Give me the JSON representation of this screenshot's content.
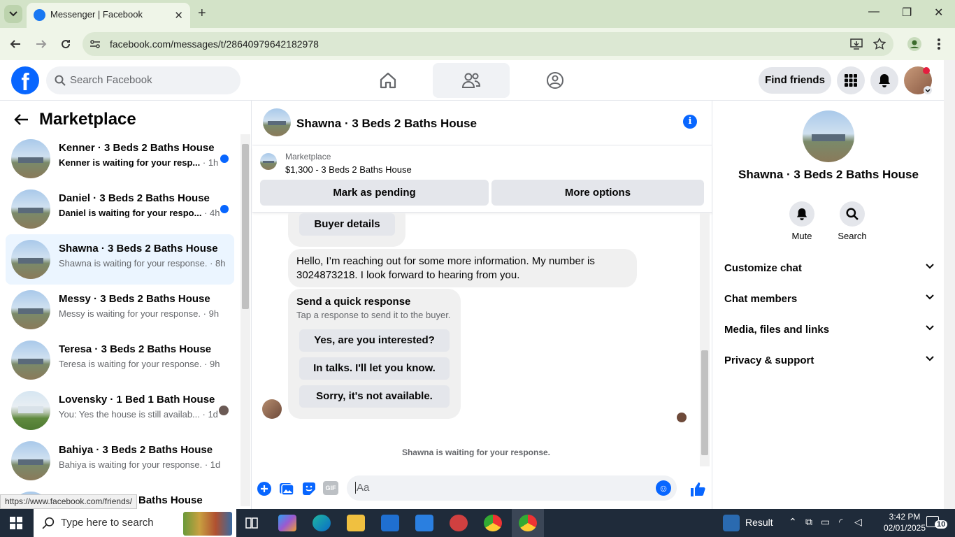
{
  "browser": {
    "tab_title": "Messenger | Facebook",
    "url": "facebook.com/messages/t/28640979642182978",
    "status_url": "https://www.facebook.com/friends/"
  },
  "fb": {
    "search_placeholder": "Search Facebook",
    "find_friends": "Find friends",
    "logo_letter": "f"
  },
  "left": {
    "title": "Marketplace",
    "chats": [
      {
        "name": "Kenner · 3 Beds 2 Baths House",
        "preview": "Kenner is waiting for your resp...",
        "time": "· 1h",
        "unread": true
      },
      {
        "name": "Daniel · 3 Beds 2 Baths House",
        "preview": "Daniel is waiting for your respo...",
        "time": "· 4h",
        "unread": true
      },
      {
        "name": "Shawna · 3 Beds 2 Baths House",
        "preview": "Shawna is waiting for your response.",
        "time": "· 8h",
        "unread": false
      },
      {
        "name": "Messy · 3 Beds 2 Baths House",
        "preview": "Messy is waiting for your response.",
        "time": "· 9h",
        "unread": false
      },
      {
        "name": "Teresa · 3 Beds 2 Baths House",
        "preview": "Teresa is waiting for your response.",
        "time": "· 9h",
        "unread": false
      },
      {
        "name": "Lovensky · 1 Bed 1 Bath House",
        "preview": "You: Yes the house is still availab...",
        "time": "· 1d",
        "unread": false
      },
      {
        "name": "Bahiya · 3 Beds 2 Baths House",
        "preview": "Bahiya is waiting for your response.",
        "time": "· 1d",
        "unread": false
      },
      {
        "name": "Baths House",
        "preview": "",
        "time": "",
        "unread": false
      }
    ]
  },
  "conversation": {
    "title": "Shawna · 3 Beds 2 Baths House",
    "marketplace_label": "Marketplace",
    "listing": "$1,300 - 3 Beds 2 Baths House",
    "mark_pending": "Mark as pending",
    "more_options": "More options",
    "buyer_details": "Buyer details",
    "message_line1": "Hello, I’m reaching out for some more information. My number is",
    "message_line2": "3024873218. I look forward to hearing from you.",
    "quick_title": "Send a quick response",
    "quick_sub": "Tap a response to send it to the buyer.",
    "quick_replies": [
      "Yes, are you interested?",
      "In talks. I'll let you know.",
      "Sorry, it's not available."
    ],
    "waiting": "Shawna is waiting for your response.",
    "composer_placeholder": "Aa",
    "gif_label": "GIF"
  },
  "right": {
    "name": "Shawna · 3 Beds 2 Baths House",
    "mute": "Mute",
    "search": "Search",
    "rows": [
      "Customize chat",
      "Chat members",
      "Media, files and links",
      "Privacy & support"
    ]
  },
  "taskbar": {
    "search_placeholder": "Type here to search",
    "result_label": "Result",
    "time": "3:42 PM",
    "date": "02/01/2025",
    "notification_count": "10"
  },
  "colors": {
    "fb_blue": "#0866ff",
    "chrome_green": "#d3e3c8"
  }
}
